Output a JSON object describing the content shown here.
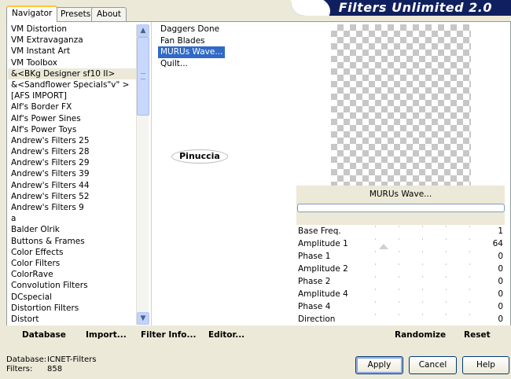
{
  "tabs": [
    "Navigator",
    "Presets",
    "About"
  ],
  "app_title": "Filters Unlimited 2.0",
  "categories": [
    "VM Distortion",
    "VM Extravaganza",
    "VM Instant Art",
    "VM Toolbox",
    "&<BKg Designer sf10 II>",
    "&<Sandflower Specials\"v\" >",
    "[AFS IMPORT]",
    "Alf's Border FX",
    "Alf's Power Sines",
    "Alf's Power Toys",
    "Andrew's Filters 25",
    "Andrew's Filters 28",
    "Andrew's Filters 29",
    "Andrew's Filters 39",
    "Andrew's Filters 44",
    "Andrew's Filters 52",
    "Andrew's Filters 9",
    "a",
    "Balder Olrik",
    "Buttons & Frames",
    "Color Effects",
    "Color Filters",
    "ColorRave",
    "Convolution Filters",
    "DCspecial",
    "Distortion Filters",
    "Distort"
  ],
  "selected_category": "&<BKg Designer sf10 II>",
  "filters": [
    "Daggers Done",
    "Fan Blades",
    "MURUs Wave...",
    "Quilt..."
  ],
  "selected_filter": "MURUs Wave...",
  "watermark": "Pinuccia",
  "filter_name": "MURUs Wave...",
  "params": [
    {
      "label": "Base Freq.",
      "value": "1"
    },
    {
      "label": "Amplitude 1",
      "value": "64"
    },
    {
      "label": "Phase 1",
      "value": "0"
    },
    {
      "label": "Amplitude 2",
      "value": "0"
    },
    {
      "label": "Phase 2",
      "value": "0"
    },
    {
      "label": "Amplitude 4",
      "value": "0"
    },
    {
      "label": "Phase 4",
      "value": "0"
    },
    {
      "label": "Direction",
      "value": "0"
    }
  ],
  "bottom_buttons": {
    "database": "Database",
    "import": "Import...",
    "filter_info": "Filter Info...",
    "editor": "Editor...",
    "randomize": "Randomize",
    "reset": "Reset"
  },
  "status": {
    "database_label": "Database:",
    "database_value": "ICNET-Filters",
    "filters_label": "Filters:",
    "filters_value": "858"
  },
  "dialog_buttons": {
    "apply": "Apply",
    "cancel": "Cancel",
    "help": "Help"
  },
  "colors": {
    "selection": "#316ac5",
    "title_bg": "#10205e",
    "tab_highlight": "#ffc83c"
  }
}
